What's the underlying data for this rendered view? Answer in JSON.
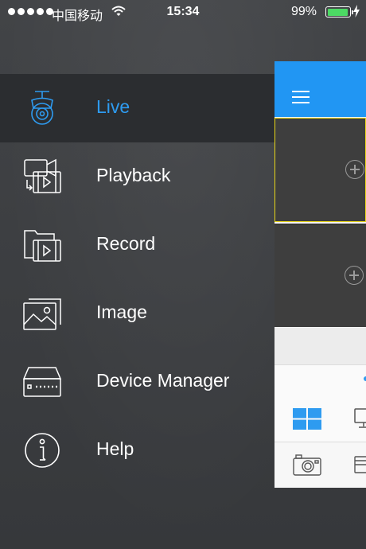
{
  "status_bar": {
    "carrier": "中国移动",
    "time": "15:34",
    "battery_percent": "99%",
    "battery_level": 0.99,
    "icons": [
      "signal-dots-icon",
      "wifi-icon",
      "battery-icon",
      "charging-bolt-icon"
    ]
  },
  "menu": {
    "items": [
      {
        "label": "Live",
        "icon": "camera-icon",
        "active": true
      },
      {
        "label": "Playback",
        "icon": "playback-icon",
        "active": false
      },
      {
        "label": "Record",
        "icon": "record-folder-icon",
        "active": false
      },
      {
        "label": "Image",
        "icon": "image-icon",
        "active": false
      },
      {
        "label": "Device Manager",
        "icon": "nvr-device-icon",
        "active": false
      },
      {
        "label": "Help",
        "icon": "info-icon",
        "active": false
      }
    ]
  },
  "colors": {
    "accent": "#2e9bf0",
    "header_blue": "#2196f3",
    "selected_tile_border": "#e8d619",
    "menu_background": "#3d3f42",
    "active_row": "#2b2d30"
  },
  "live_panel": {
    "icons": [
      "hamburger-menu-icon",
      "add-channel-icon",
      "split-screen-grid-icon",
      "monitor-icon",
      "snapshot-camera-icon",
      "device-icon"
    ]
  }
}
